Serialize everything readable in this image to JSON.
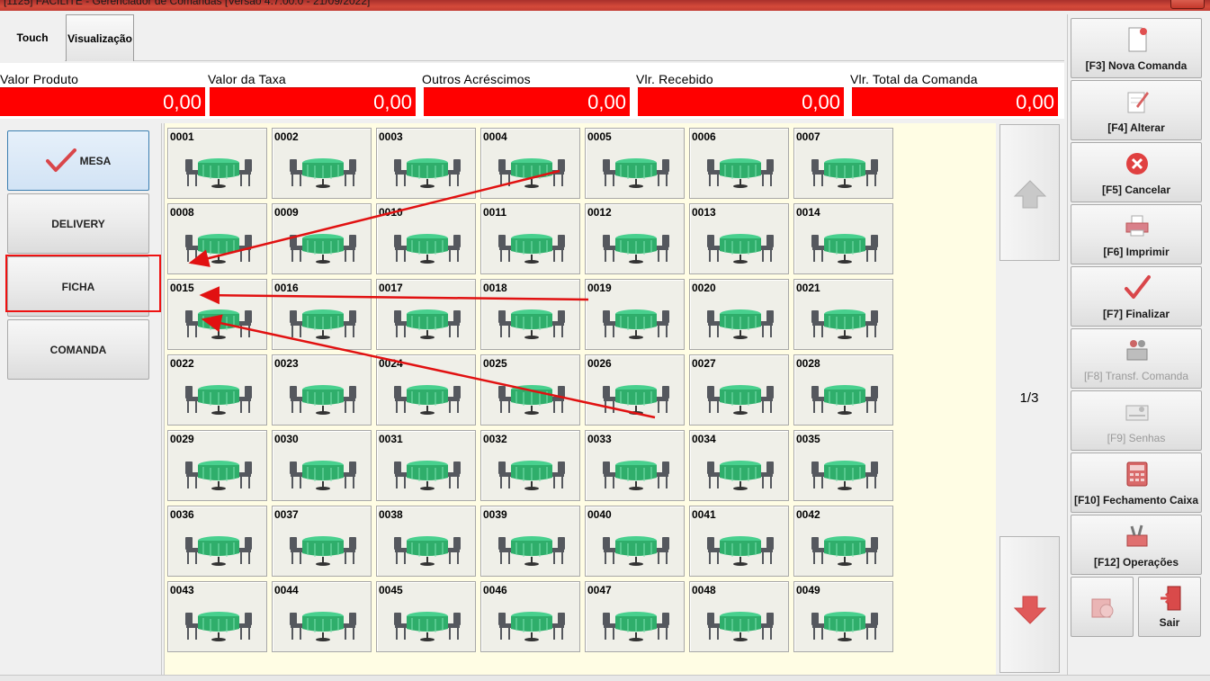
{
  "window": {
    "title": "[1125] FACILITE - Gerenciador de Comandas [Versão 4.7.00.0 - 21/09/2022]"
  },
  "tabs": [
    {
      "label": "Touch",
      "active": true
    },
    {
      "label": "Visualização",
      "active": false
    }
  ],
  "totals": [
    {
      "label": "Valor Produto",
      "value": "0,00"
    },
    {
      "label": "Valor da Taxa",
      "value": "0,00"
    },
    {
      "label": "Outros Acréscimos",
      "value": "0,00"
    },
    {
      "label": "Vlr. Recebido",
      "value": "0,00"
    },
    {
      "label": "Vlr. Total da Comanda",
      "value": "0,00"
    }
  ],
  "modes": [
    {
      "label": "MESA",
      "selected": true,
      "icon": "checkmark-icon"
    },
    {
      "label": "DELIVERY",
      "selected": false
    },
    {
      "label": "FICHA",
      "selected": false,
      "highlighted": true
    },
    {
      "label": "COMANDA",
      "selected": false
    }
  ],
  "tables": [
    "0001",
    "0002",
    "0003",
    "0004",
    "0005",
    "0006",
    "0007",
    "0008",
    "0009",
    "0010",
    "0011",
    "0012",
    "0013",
    "0014",
    "0015",
    "0016",
    "0017",
    "0018",
    "0019",
    "0020",
    "0021",
    "0022",
    "0023",
    "0024",
    "0025",
    "0026",
    "0027",
    "0028",
    "0029",
    "0030",
    "0031",
    "0032",
    "0033",
    "0034",
    "0035",
    "0036",
    "0037",
    "0038",
    "0039",
    "0040",
    "0041",
    "0042",
    "0043",
    "0044",
    "0045",
    "0046",
    "0047",
    "0048",
    "0049"
  ],
  "pagination": {
    "indicator": "1/3"
  },
  "functions": [
    {
      "label": "[F3] Nova Comanda",
      "icon": "new-document-icon",
      "enabled": true
    },
    {
      "label": "[F4] Alterar",
      "icon": "edit-note-icon",
      "enabled": true
    },
    {
      "label": "[F5] Cancelar",
      "icon": "cancel-icon",
      "enabled": true
    },
    {
      "label": "[F6] Imprimir",
      "icon": "printer-icon",
      "enabled": true
    },
    {
      "label": "[F7] Finalizar",
      "icon": "checkmark-icon",
      "enabled": true
    },
    {
      "label": "[F8] Transf. Comanda",
      "icon": "transfer-icon",
      "enabled": false
    },
    {
      "label": "[F9] Senhas",
      "icon": "id-card-icon",
      "enabled": false
    },
    {
      "label": "[F10] Fechamento Caixa",
      "icon": "calculator-icon",
      "enabled": true
    },
    {
      "label": "[F12] Operações",
      "icon": "tools-icon",
      "enabled": true
    }
  ],
  "bottom_buttons": [
    {
      "label": "",
      "icon": "settings-icon"
    },
    {
      "label": "Sair",
      "icon": "exit-door-icon"
    }
  ],
  "colors": {
    "total_box": "#ff0000",
    "grid_bg": "#fffde4",
    "annotation": "#e11111",
    "table_top": "#2fae6b"
  }
}
